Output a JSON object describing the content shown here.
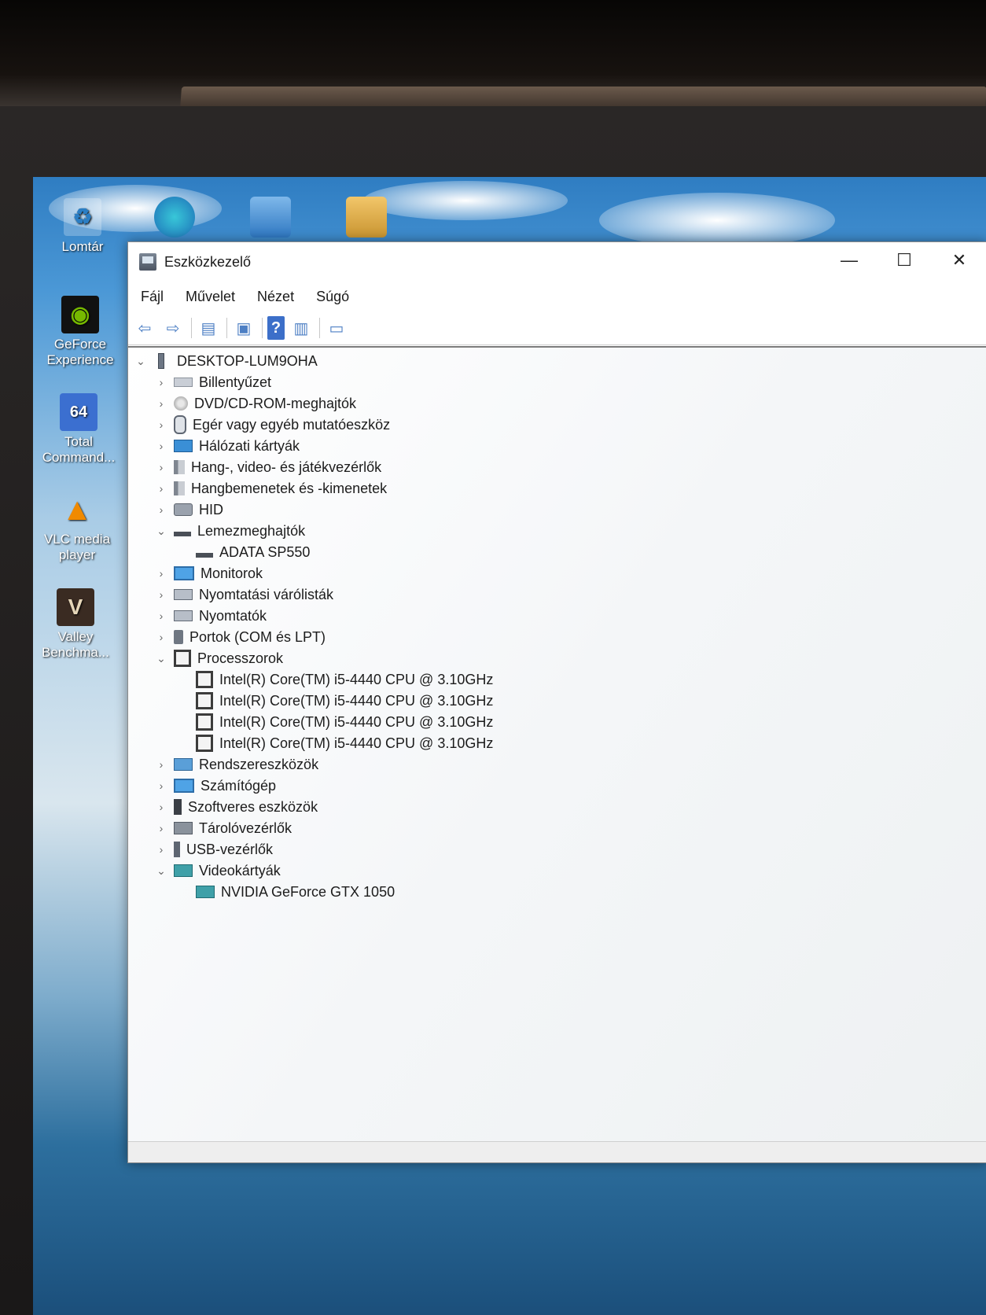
{
  "desktop": {
    "icons": [
      {
        "label": "Lomtár",
        "icon": "recycle-bin-icon"
      },
      {
        "label": "GeForce Experience",
        "icon": "geforce-icon"
      },
      {
        "label": "Total Command...",
        "icon": "floppy-icon"
      },
      {
        "label": "VLC media player",
        "icon": "vlc-cone-icon"
      },
      {
        "label": "Valley Benchma...",
        "icon": "valley-icon"
      }
    ]
  },
  "window": {
    "title": "Eszközkezelő",
    "minimize": "—",
    "maximize": "☐",
    "close": "✕"
  },
  "menu": [
    "Fájl",
    "Művelet",
    "Nézet",
    "Súgó"
  ],
  "toolbar": {
    "back": "⇦",
    "forward": "⇨",
    "show_hide": "▤",
    "properties": "▣",
    "help": "?",
    "view": "▥",
    "monitor": "▭"
  },
  "tree": {
    "root": "DESKTOP-LUM9OHA",
    "nodes": [
      {
        "label": "Billentyűzet",
        "expanded": false
      },
      {
        "label": "DVD/CD-ROM-meghajtók",
        "expanded": false
      },
      {
        "label": "Egér vagy egyéb mutatóeszköz",
        "expanded": false
      },
      {
        "label": "Hálózati kártyák",
        "expanded": false
      },
      {
        "label": "Hang-, video- és játékvezérlők",
        "expanded": false
      },
      {
        "label": "Hangbemenetek és -kimenetek",
        "expanded": false
      },
      {
        "label": "HID",
        "expanded": false
      },
      {
        "label": "Lemezmeghajtók",
        "expanded": true,
        "children": [
          "ADATA SP550"
        ]
      },
      {
        "label": "Monitorok",
        "expanded": false
      },
      {
        "label": "Nyomtatási várólisták",
        "expanded": false
      },
      {
        "label": "Nyomtatók",
        "expanded": false
      },
      {
        "label": "Portok (COM és LPT)",
        "expanded": false
      },
      {
        "label": "Processzorok",
        "expanded": true,
        "children": [
          "Intel(R) Core(TM) i5-4440 CPU @ 3.10GHz",
          "Intel(R) Core(TM) i5-4440 CPU @ 3.10GHz",
          "Intel(R) Core(TM) i5-4440 CPU @ 3.10GHz",
          "Intel(R) Core(TM) i5-4440 CPU @ 3.10GHz"
        ]
      },
      {
        "label": "Rendszereszközök",
        "expanded": false
      },
      {
        "label": "Számítógép",
        "expanded": false
      },
      {
        "label": "Szoftveres eszközök",
        "expanded": false
      },
      {
        "label": "Tárolóvezérlők",
        "expanded": false
      },
      {
        "label": "USB-vezérlők",
        "expanded": false
      },
      {
        "label": "Videokártyák",
        "expanded": true,
        "children": [
          "NVIDIA GeForce GTX 1050"
        ]
      }
    ]
  }
}
